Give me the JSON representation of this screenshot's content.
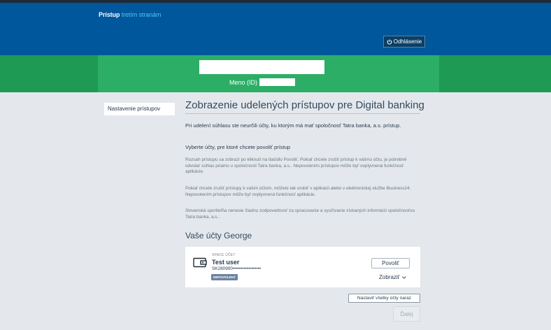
{
  "header": {
    "brand_main": "Prístup",
    "brand_accent": "tretím stranám",
    "logout_label": "Odhlásenie"
  },
  "user": {
    "name_label": "Meno (ID)"
  },
  "sidebar": {
    "items": [
      {
        "label": "Nastavenie prístupov"
      }
    ]
  },
  "main": {
    "title": "Zobrazenie udelených prístupov pre Digital banking",
    "intro": "Pri udelení súhlasu ste neurčili účty, ku ktorým má mať spoločnosť Tatra banka, a.s. prístup.",
    "select_heading": "Vyberte účty, pre ktoré chcete povoliť prístup",
    "paragraphs": [
      "Rozsah prístupu sa zobrazí po kliknutí na tlačidlo Povoliť. Pokiaľ chcete zrušiť prístup k vášmu účtu, je potrebné odvolať súhlas priamo u spoločnosti Tatra banka, a.s.. Nepovolením prístupov môže byť ovplyvnená funkčnosť aplikácie.",
      "Pokiaľ chcete zrušiť prístupy k vašim účtom, môžete tak urobiť v aplikácii alebo v elektronickej službe Business24. Nepovolením prístupov môže byť ovplyvnená funkčnosť aplikácie.",
      "Slovenská sporiteľňa nenesie žiadnu zodpovednosť za spracovanie a využívanie získaných informácií spoločnosťou Tatra banka, a.s.."
    ],
    "accounts_title": "Vaše účty George",
    "accounts": [
      {
        "type": "SPACE ÚČET",
        "name": "Test user",
        "iban": "SK280900••••••••••••••••••",
        "status": "NEPOVOLENÝ",
        "allow_label": "Povoliť",
        "show_label": "Zobraziť"
      }
    ],
    "set_all_label": "Nastaviť všetky účty naraz",
    "next_label": "Ďalej"
  },
  "colors": {
    "header_blue": "#01579b",
    "band_green": "#2cae66",
    "page_bg": "#e4e8ec",
    "badge": "#6d82a1"
  }
}
